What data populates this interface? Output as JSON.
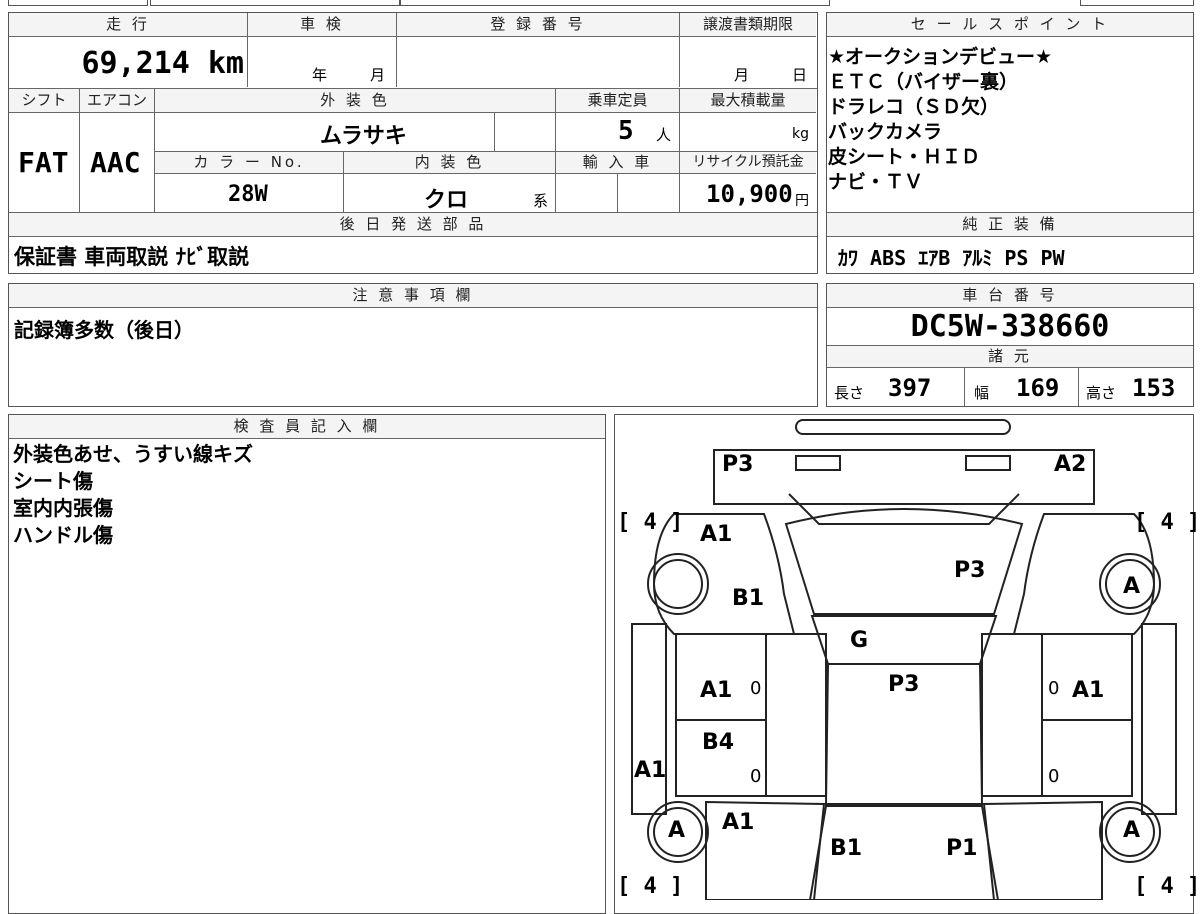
{
  "spec": {
    "headers": {
      "mileage": "走 行",
      "inspection": "車 検",
      "registration": "登 録 番 号",
      "transfer_deadline": "譲渡書類期限",
      "shift": "シフト",
      "aircon": "エアコン",
      "exterior_color": "外 装 色",
      "capacity": "乗車定員",
      "max_load": "最大積載量",
      "color_no": "カ ラ ー No.",
      "interior_color": "内 装 色",
      "import": "輸 入 車",
      "recycle": "リサイクル預託金",
      "later_parts": "後 日 発 送 部 品"
    },
    "mileage_value": "69,214 km",
    "inspection_year_unit": "年",
    "inspection_month_unit": "月",
    "transfer_month_unit": "月",
    "transfer_day_unit": "日",
    "shift_value": "FAT",
    "aircon_value": "AAC",
    "exterior_color_value": "ムラサキ",
    "capacity_value": "5",
    "capacity_unit": "人",
    "max_load_unit": "kg",
    "color_no_value": "28W",
    "interior_color_value": "クロ",
    "interior_color_suffix": "系",
    "recycle_value": "10,900",
    "recycle_unit": "円",
    "later_parts_value": "保証書 車両取説 ﾅﾋﾞ取説"
  },
  "sales": {
    "header": "セ ー ル ス ポ イ ン ト",
    "lines": [
      "★オークションデビュー★",
      "ＥＴＣ（バイザー裏）",
      "ドラレコ（ＳＤ欠）",
      "バックカメラ",
      "皮シート・ＨＩＤ",
      "ナビ・ＴＶ"
    ],
    "equipment_header": "純 正 装 備",
    "equipment_value": "ｶﾜ ABS ｴｱB ｱﾙﾐ PS PW"
  },
  "notes": {
    "header": "注 意 事 項 欄",
    "value": "記録簿多数（後日）"
  },
  "chassis": {
    "header": "車 台 番 号",
    "value": "DC5W-338660",
    "dims_header": "諸 元",
    "length_label": "長さ",
    "length_value": "397",
    "width_label": "幅",
    "width_value": "169",
    "height_label": "高さ",
    "height_value": "153"
  },
  "inspector": {
    "header": "検 査 員 記 入 欄",
    "lines": [
      "外装色あせ、うすい線キズ",
      "シート傷",
      "室内内張傷",
      "ハンドル傷"
    ]
  },
  "diagram": {
    "tire_front_left": "[ 4 ]",
    "tire_front_right": "[ 4 ]",
    "tire_rear_left": "[ 4 ]",
    "tire_rear_right": "[ 4 ]",
    "marks": {
      "front_left_corner": "P3",
      "front_right_corner": "A2",
      "left_fender": "A1",
      "left_fender_lower": "B1",
      "hood": "P3",
      "windshield": "G",
      "roof": "P3",
      "left_front_door": "A1",
      "left_rear_door": "B4",
      "left_sill": "A1",
      "left_rear_quarter": "A1",
      "right_front_door": "A1",
      "rear_left": "B1",
      "rear_right": "P1",
      "wheel_fr": "A",
      "wheel_rl": "A",
      "wheel_rr": "A",
      "door_handle": "0"
    }
  }
}
